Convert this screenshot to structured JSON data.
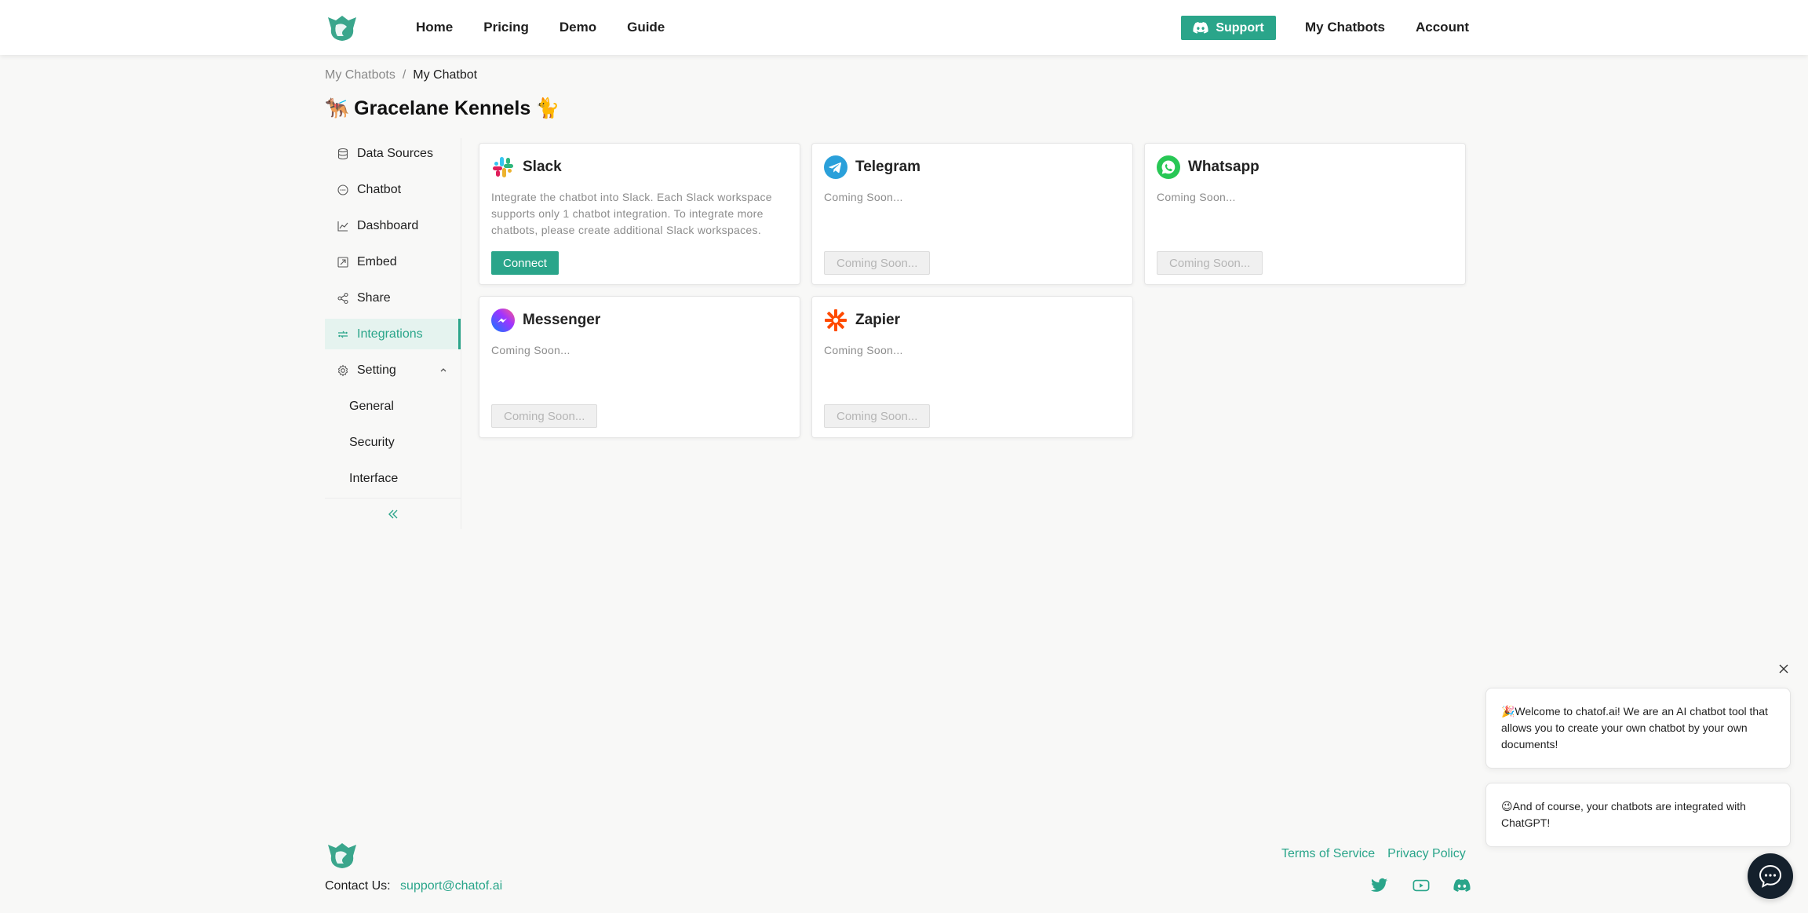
{
  "colors": {
    "accent": "#2aa58a",
    "accent_light": "#e5f3ef",
    "launcher": "#14202c"
  },
  "header": {
    "nav_left": [
      "Home",
      "Pricing",
      "Demo",
      "Guide"
    ],
    "support_label": "Support",
    "nav_right": [
      "My Chatbots",
      "Account"
    ]
  },
  "breadcrumb": {
    "parent": "My Chatbots",
    "separator": "/",
    "current": "My Chatbot"
  },
  "page": {
    "title": "Gracelane Kennels",
    "emoji_left": "🐕‍🦺",
    "emoji_right": "🐈"
  },
  "sidebar": {
    "items": [
      {
        "label": "Data Sources",
        "icon": "database-icon"
      },
      {
        "label": "Chatbot",
        "icon": "chat-icon"
      },
      {
        "label": "Dashboard",
        "icon": "line-chart-icon"
      },
      {
        "label": "Embed",
        "icon": "embed-icon"
      },
      {
        "label": "Share",
        "icon": "share-icon"
      },
      {
        "label": "Integrations",
        "icon": "integrations-icon",
        "active": true
      },
      {
        "label": "Setting",
        "icon": "gear-icon",
        "expanded": true
      }
    ],
    "sub_items": [
      "General",
      "Security",
      "Interface"
    ],
    "collapse_icon": "double-chevron-left-icon"
  },
  "integrations": [
    {
      "name": "Slack",
      "icon": "slack-icon",
      "description": "Integrate the chatbot into Slack. Each Slack workspace supports only 1 chatbot integration. To integrate more chatbots, please create additional Slack workspaces.",
      "button": "Connect",
      "enabled": true
    },
    {
      "name": "Telegram",
      "icon": "telegram-icon",
      "description": "Coming Soon...",
      "button": "Coming Soon...",
      "enabled": false
    },
    {
      "name": "Whatsapp",
      "icon": "whatsapp-icon",
      "description": "Coming Soon...",
      "button": "Coming Soon...",
      "enabled": false
    },
    {
      "name": "Messenger",
      "icon": "messenger-icon",
      "description": "Coming Soon...",
      "button": "Coming Soon...",
      "enabled": false
    },
    {
      "name": "Zapier",
      "icon": "zapier-icon",
      "description": "Coming Soon...",
      "button": "Coming Soon...",
      "enabled": false
    }
  ],
  "chat": {
    "messages": [
      "🎉Welcome to chatof.ai! We are an AI chatbot tool that allows you to create your own chatbot by your own documents!",
      "😉And of course, your chatbots are integrated with ChatGPT!"
    ]
  },
  "footer": {
    "contact_label": "Contact Us:",
    "contact_email": "support@chatof.ai",
    "links": [
      "Terms of Service",
      "Privacy Policy"
    ],
    "social": [
      "twitter-icon",
      "youtube-icon",
      "discord-icon"
    ]
  }
}
